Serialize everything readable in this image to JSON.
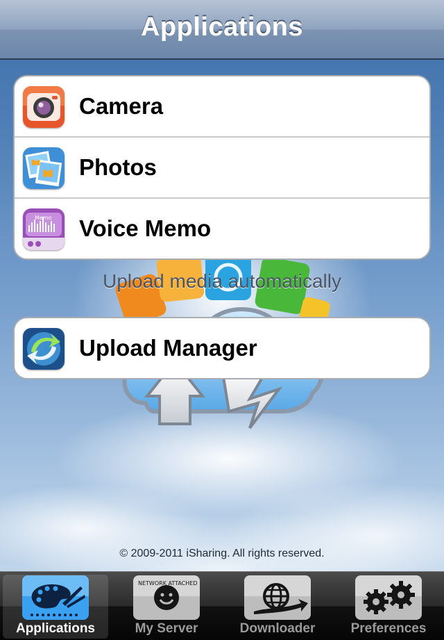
{
  "navbar": {
    "title": "Applications"
  },
  "applications": [
    {
      "label": "Camera",
      "icon": "camera-icon"
    },
    {
      "label": "Photos",
      "icon": "photos-icon"
    },
    {
      "label": "Voice Memo",
      "icon": "voice-memo-icon",
      "icon_text": "Memo"
    }
  ],
  "caption": "Upload media automatically",
  "upload_manager": {
    "label": "Upload Manager",
    "icon": "upload-manager-icon"
  },
  "copyright": "© 2009-2011 iSharing. All rights reserved.",
  "tabbar": {
    "tabs": [
      {
        "label": "Applications",
        "icon": "palette-icon",
        "selected": true
      },
      {
        "label": "My Server",
        "icon": "smiley-icon",
        "selected": false,
        "icon_text": "NETWORK ATTACHED"
      },
      {
        "label": "Downloader",
        "icon": "globe-icon",
        "selected": false
      },
      {
        "label": "Preferences",
        "icon": "gears-icon",
        "selected": false
      }
    ]
  },
  "colors": {
    "navbar_top": "#b6c3d5",
    "navbar_bottom": "#6c86aa",
    "tabbar": "#111111",
    "selected_tab_icon": "#3aa0f0"
  }
}
